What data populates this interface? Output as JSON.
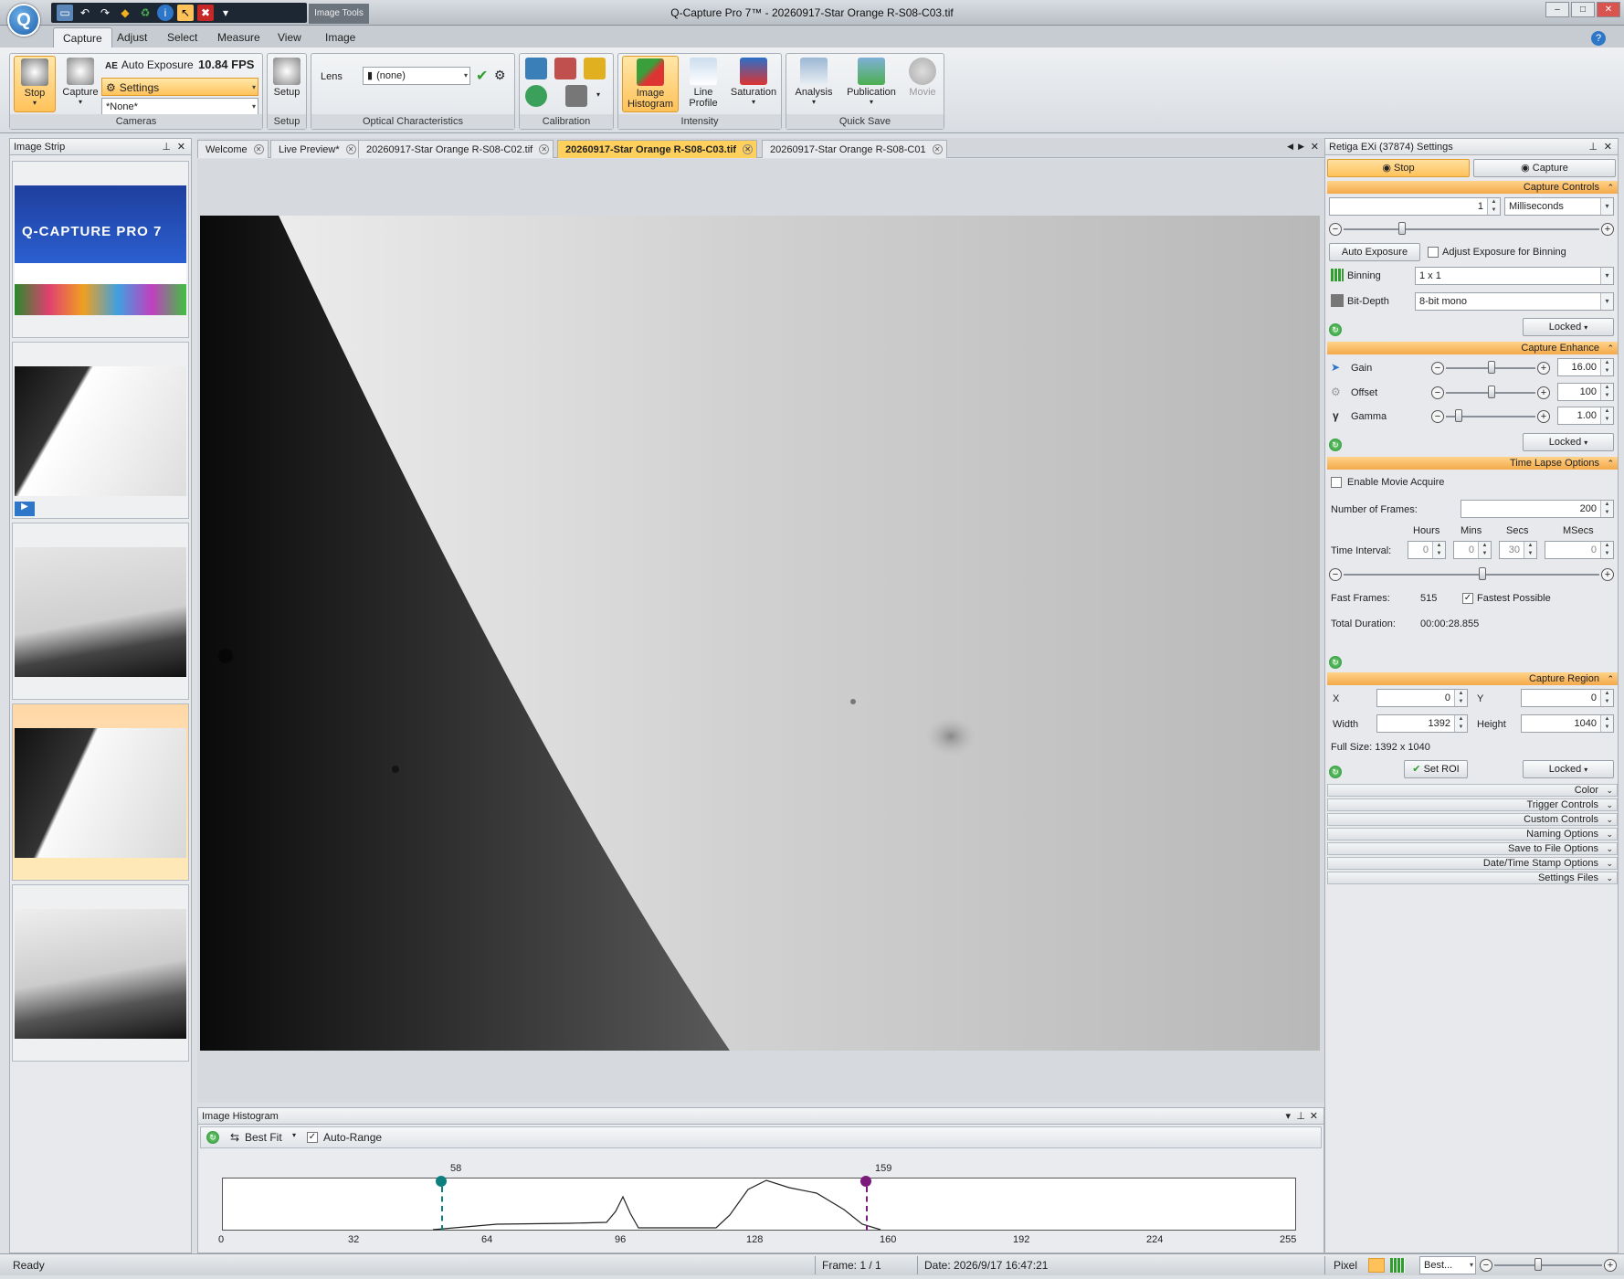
{
  "window": {
    "title": "Q-Capture Pro 7™ - 20260917-Star Orange R-S08-C03.tif",
    "context_tab": "Image Tools"
  },
  "ribbon_tabs": [
    "Capture",
    "Adjust",
    "Select",
    "Measure",
    "View",
    "Image"
  ],
  "ribbon": {
    "cameras": {
      "stop": "Stop",
      "capture": "Capture",
      "auto_exposure": "Auto Exposure",
      "fps": "10.84 FPS",
      "settings": "Settings",
      "preset": "*None*",
      "label": "Cameras"
    },
    "setup": {
      "button": "Setup",
      "label": "Setup"
    },
    "optical": {
      "lens_label": "Lens",
      "lens_value": "(none)",
      "label": "Optical Characteristics"
    },
    "calibration": {
      "label": "Calibration"
    },
    "intensity": {
      "histogram_line1": "Image",
      "histogram_line2": "Histogram",
      "profile_line1": "Line",
      "profile_line2": "Profile",
      "saturation": "Saturation",
      "label": "Intensity"
    },
    "quicksave": {
      "analysis": "Analysis",
      "publication": "Publication",
      "movie": "Movie",
      "label": "Quick Save"
    }
  },
  "image_strip": {
    "title": "Image Strip",
    "logo_title": "Q-CAPTURE PRO 7"
  },
  "doc_tabs": [
    "Welcome",
    "Live Preview*",
    "20260917-Star Orange R-S08-C02.tif",
    "20260917-Star Orange R-S08-C03.tif",
    "20260917-Star Orange R-S08-C01"
  ],
  "histogram": {
    "title": "Image Histogram",
    "fit": "Best Fit",
    "auto_range": "Auto-Range",
    "low_marker": 58,
    "high_marker": 159,
    "ticks": [
      "0",
      "32",
      "64",
      "96",
      "128",
      "160",
      "192",
      "224",
      "255"
    ]
  },
  "settings": {
    "title": "Retiga EXi (37874) Settings",
    "stop": "Stop",
    "capture": "Capture",
    "capture_controls": "Capture Controls",
    "exposure_value": "1",
    "exposure_unit": "Milliseconds",
    "auto_exposure": "Auto Exposure",
    "adjust_binning": "Adjust Exposure for Binning",
    "binning_label": "Binning",
    "binning_value": "1 x 1",
    "bitdepth_label": "Bit-Depth",
    "bitdepth_value": "8-bit mono",
    "locked": "Locked",
    "capture_enhance": "Capture Enhance",
    "gain_label": "Gain",
    "gain_value": "16.00",
    "offset_label": "Offset",
    "offset_value": "100",
    "gamma_label": "Gamma",
    "gamma_value": "1.00",
    "timelapse": "Time Lapse Options",
    "enable_movie": "Enable Movie Acquire",
    "frames_label": "Number of  Frames:",
    "frames_value": "200",
    "hours": "Hours",
    "mins": "Mins",
    "secs": "Secs",
    "msecs": "MSecs",
    "interval_label": "Time Interval:",
    "hours_value": "0",
    "mins_value": "0",
    "secs_value": "30",
    "msecs_value": "0",
    "fast_frames_label": "Fast Frames:",
    "fast_frames_value": "515",
    "fastest": "Fastest Possible",
    "total_label": "Total Duration:",
    "total_value": "00:00:28.855",
    "capture_region": "Capture Region",
    "x_label": "X",
    "x_value": "0",
    "y_label": "Y",
    "y_value": "0",
    "width_label": "Width",
    "width_value": "1392",
    "height_label": "Height",
    "height_value": "1040",
    "fullsize": "Full Size: 1392 x 1040",
    "set_roi": "Set ROI",
    "collapsed": [
      "Color",
      "Trigger Controls",
      "Custom Controls",
      "Naming Options",
      "Save to File Options",
      "Date/Time Stamp Options",
      "Settings Files"
    ]
  },
  "status": {
    "ready": "Ready",
    "frame": "Frame: 1 / 1",
    "date": "Date: 2026/9/17 16:47:21",
    "pixel": "Pixel",
    "zoom": "Best..."
  },
  "colors": {
    "accent": "#ffc25a",
    "selected_tab": "#ffd15c",
    "low_marker": "#0e7f7f",
    "high_marker": "#7a1a7a"
  }
}
